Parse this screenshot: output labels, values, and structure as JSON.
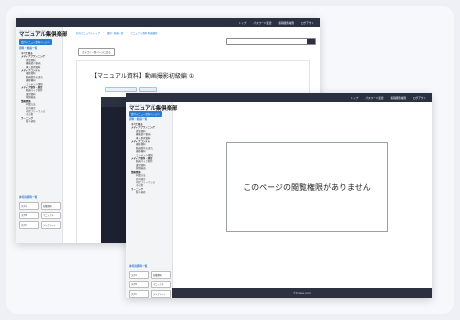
{
  "nav": {
    "items": [
      "トップ",
      "パスワード変更",
      "投稿閲覧権限",
      "ログアウト"
    ]
  },
  "logo": {
    "sub": "コンシェルジュ マニュアル",
    "main": "マニュアル集倶楽部"
  },
  "sidebar": {
    "tag": "受付メニュー案内ページへ",
    "heading": "資料・動画一覧",
    "items": [
      {
        "label": "すべて見る",
        "type": "cat"
      },
      {
        "label": "メディアプランニング",
        "type": "cat"
      },
      {
        "label": "提案資料",
        "type": "sub"
      },
      {
        "label": "機能紹介動画",
        "type": "sub"
      },
      {
        "label": "導入事例資料",
        "type": "sub"
      },
      {
        "label": "メディアコンテル",
        "type": "cat"
      },
      {
        "label": "撮影資料",
        "type": "sub"
      },
      {
        "label": "動画制作の流れ",
        "type": "sub"
      },
      {
        "label": "撮影機材",
        "type": "sub"
      },
      {
        "label": "コンテンツ資料",
        "type": "sub"
      },
      {
        "label": "メディア制作・運営",
        "type": "cat"
      },
      {
        "label": "動画マイク制作",
        "type": "sub"
      },
      {
        "label": "運営資料",
        "type": "sub"
      },
      {
        "label": "管理画面",
        "type": "sub"
      },
      {
        "label": "業務関係",
        "type": "cat"
      },
      {
        "label": "同業方法",
        "type": "sub"
      },
      {
        "label": "社内規定",
        "type": "sub"
      },
      {
        "label": "内定フリーランス",
        "type": "sub"
      },
      {
        "label": "その他",
        "type": "sub"
      },
      {
        "label": "ラーニング",
        "type": "cat"
      },
      {
        "label": "新人研修",
        "type": "sub"
      }
    ],
    "chips_heading": "参考用資料一覧",
    "chips": [
      "タグA",
      "各種資料",
      "タグB",
      "マニュアル",
      "タグC",
      "テンプレート"
    ]
  },
  "back_window": {
    "breadcrumbs": [
      "社内マニュアルトップ",
      "資料・動画一覧",
      "マニュアル資料 動画撮影"
    ],
    "back_button": "カテゴリ一覧ページに戻る",
    "article_title": "【マニュアル資料】動画撮影初級編 ①"
  },
  "front_window": {
    "notice": "このページの閲覧権限がありません",
    "footer": "©tclass.com"
  }
}
